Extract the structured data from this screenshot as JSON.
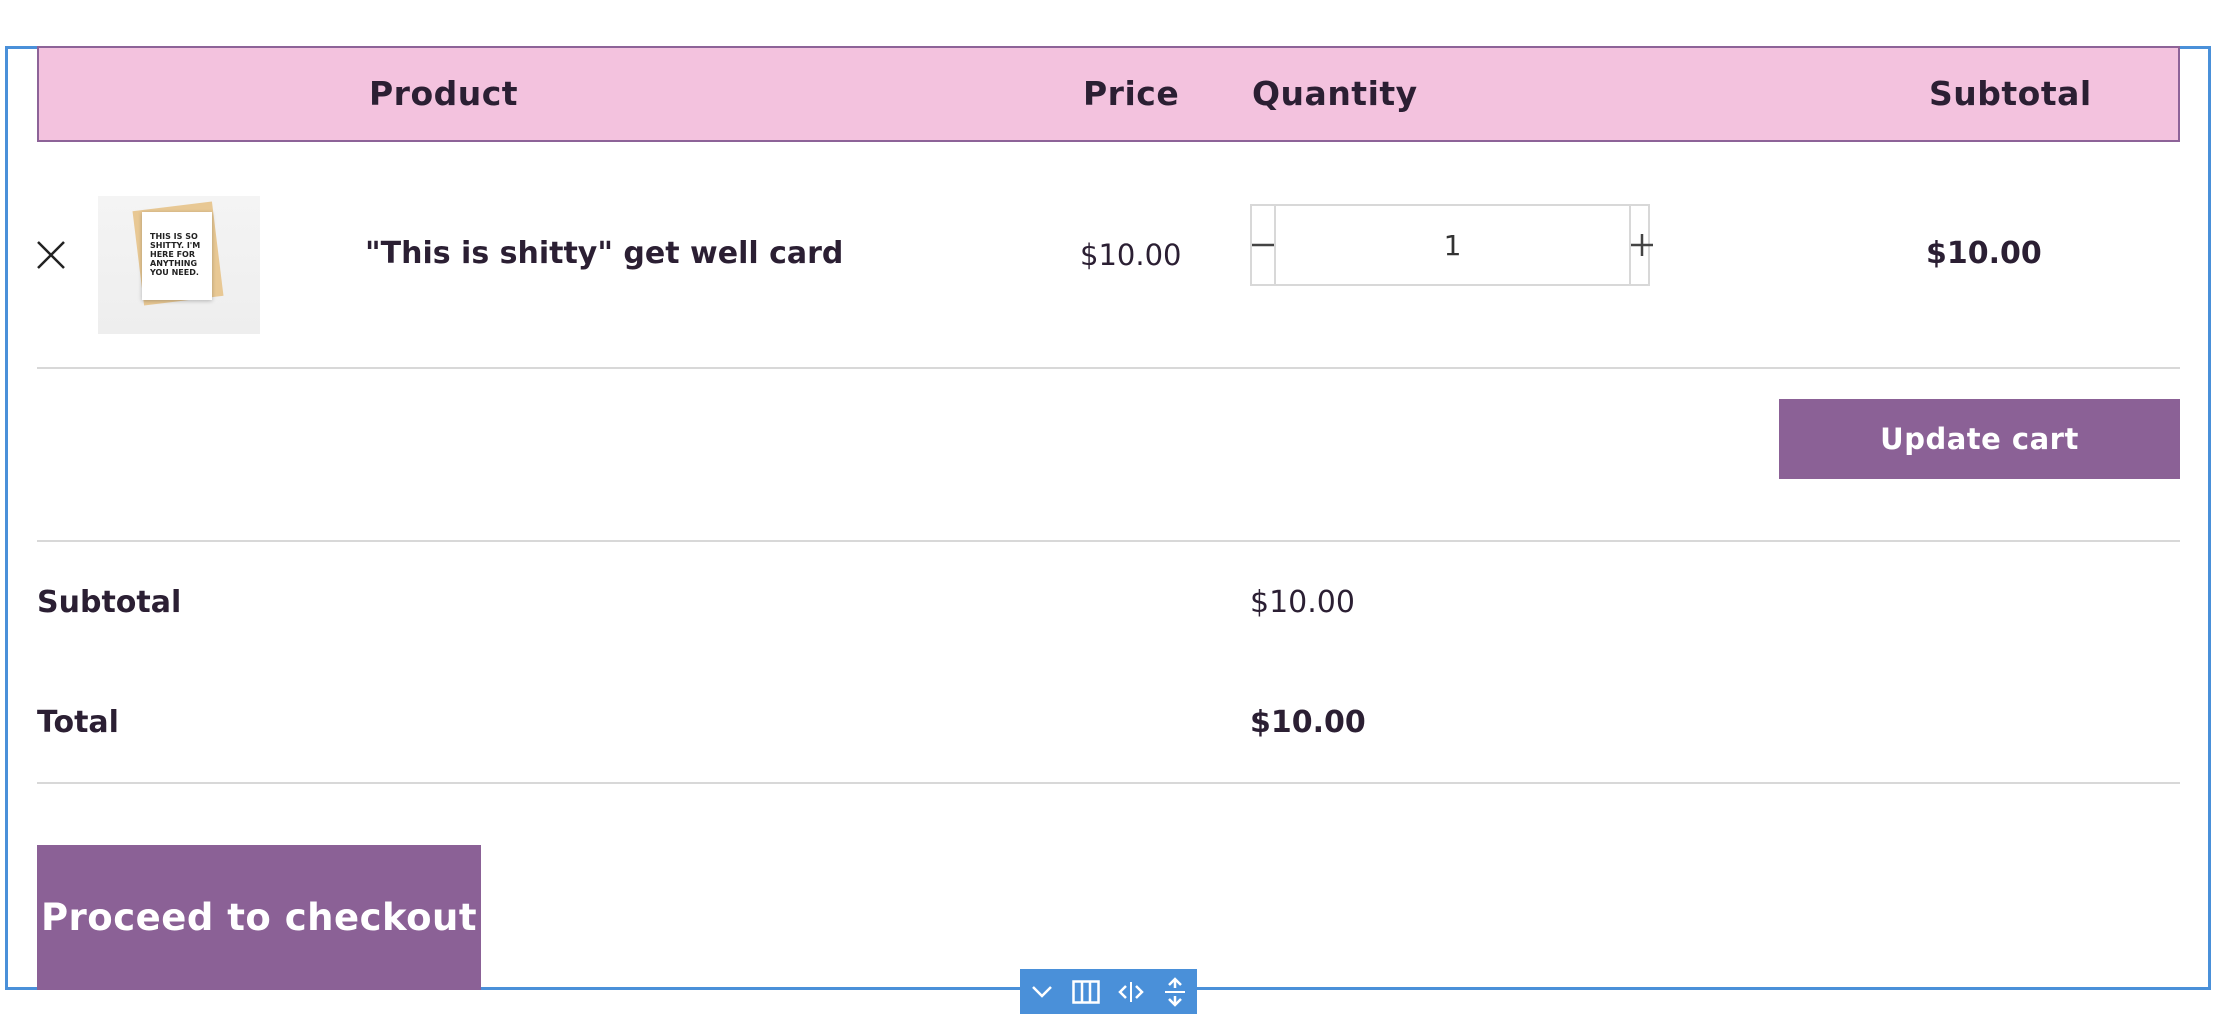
{
  "cart": {
    "headers": {
      "product": "Product",
      "price": "Price",
      "quantity": "Quantity",
      "subtotal": "Subtotal"
    },
    "items": [
      {
        "name": "\"This is shitty\" get well card",
        "image_text": "THIS IS SO SHITTY. I'M HERE FOR ANYTHING YOU NEED.",
        "price": "$10.00",
        "quantity": "1",
        "subtotal": "$10.00",
        "remove_icon": "close-x-icon"
      }
    ],
    "update_button": "Update cart"
  },
  "totals": {
    "subtotal_label": "Subtotal",
    "subtotal_value": "$10.00",
    "total_label": "Total",
    "total_value": "$10.00"
  },
  "checkout_button": "Proceed to checkout",
  "editor_toolbar": {
    "icons": [
      "chevron-down-icon",
      "columns-icon",
      "resize-horizontal-icon",
      "resize-vertical-icon"
    ]
  },
  "colors": {
    "header_bg": "#f3c2de",
    "button_bg": "#8b6196",
    "selection_border": "#4a90d9",
    "text": "#2b1f33"
  }
}
